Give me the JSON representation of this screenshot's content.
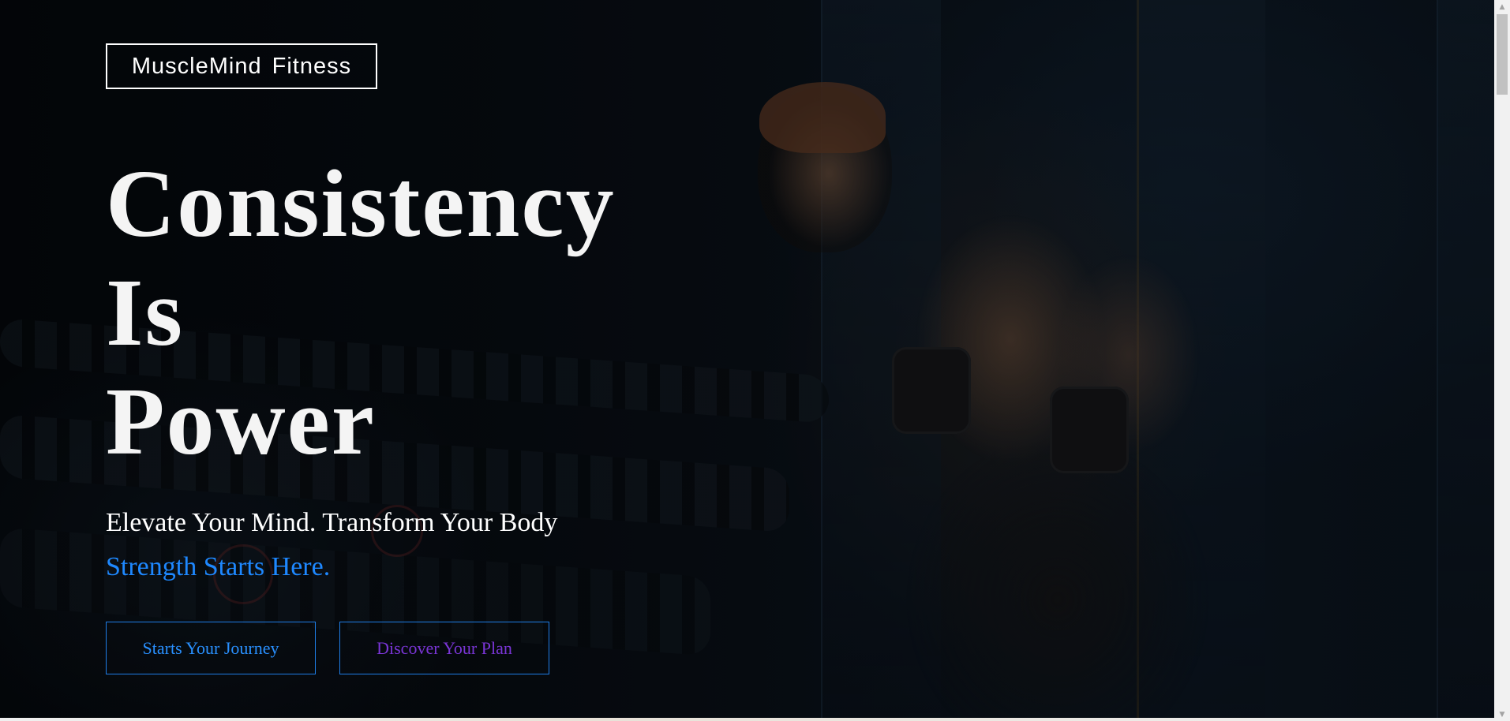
{
  "brand": {
    "logo_text": "MuscleMind Fitness"
  },
  "hero": {
    "headline_lines": [
      "Consistency",
      "Is",
      "Power"
    ],
    "tagline": "Elevate Your Mind. Transform Your Body",
    "subtagline": "Strength Starts Here.",
    "background_image": "man-lifting-dumbbell-dark-gym"
  },
  "buttons": {
    "primary_label": "Starts Your Journey",
    "secondary_label": "Discover Your Plan"
  },
  "colors": {
    "accent_blue": "#1e88ff",
    "secondary_purple": "#7a35d6",
    "headline": "#f4f4f4",
    "background": "#05080c"
  },
  "scrollbar": {
    "up_icon": "scroll-up-arrow",
    "down_icon": "scroll-down-arrow"
  }
}
